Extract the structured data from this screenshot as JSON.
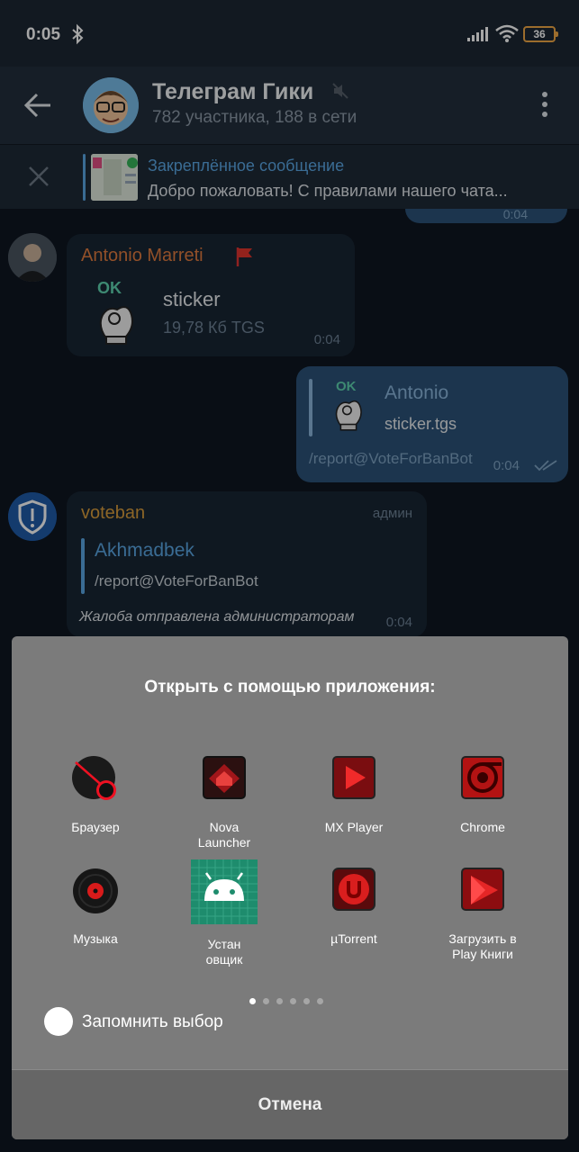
{
  "status_bar": {
    "time": "0:05",
    "battery": "36",
    "icons": [
      "bluetooth-icon",
      "signal-icon",
      "wifi-icon",
      "battery-icon"
    ]
  },
  "header": {
    "title": "Телеграм Гики",
    "subtitle": "782 участника, 188 в сети",
    "icons": [
      "back-arrow-icon",
      "mute-icon",
      "more-vert-icon"
    ]
  },
  "pinned": {
    "title": "Закреплённое сообщение",
    "text": "Добро пожаловать! С правилами нашего чата..."
  },
  "messages": {
    "top_time": "0:04",
    "m1": {
      "sender": "Antonio Marreti",
      "sticker_ok": "OK",
      "file_name": "sticker",
      "file_meta": "19,78 Кб TGS",
      "time": "0:04"
    },
    "m2": {
      "reply_name": "Antonio",
      "reply_ok": "OK",
      "reply_text": "sticker.tgs",
      "text": "/report@VoteForBanBot",
      "time": "0:04"
    },
    "m3": {
      "sender": "voteban",
      "role": "админ",
      "reply_name": "Akhmadbek",
      "reply_text": "/report@VoteForBanBot",
      "text": "Жалоба отправлена администраторам",
      "time": "0:04"
    }
  },
  "chooser": {
    "title": "Открыть с помощью приложения:",
    "apps": [
      {
        "label": "Браузер",
        "icon": "browser-icon"
      },
      {
        "label": "Nova\nLauncher",
        "icon": "nova-launcher-icon"
      },
      {
        "label": "MX Player",
        "icon": "mx-player-icon"
      },
      {
        "label": "Chrome",
        "icon": "chrome-icon"
      },
      {
        "label": "Музыка",
        "icon": "music-icon"
      },
      {
        "label": "Устан\nовщик",
        "icon": "android-installer-icon"
      },
      {
        "label": "µTorrent",
        "icon": "utorrent-icon"
      },
      {
        "label": "Загрузить в\nPlay Книги",
        "icon": "play-books-icon"
      }
    ],
    "page_count": 6,
    "current_page": 1,
    "remember_label": "Запомнить выбор",
    "cancel_label": "Отмена"
  },
  "colors": {
    "accent": "#5aa7e4",
    "sender_orange": "#e07b3f",
    "sender_gold": "#d99d3c",
    "out_bubble": "#2b5278",
    "in_bubble": "#182533"
  }
}
